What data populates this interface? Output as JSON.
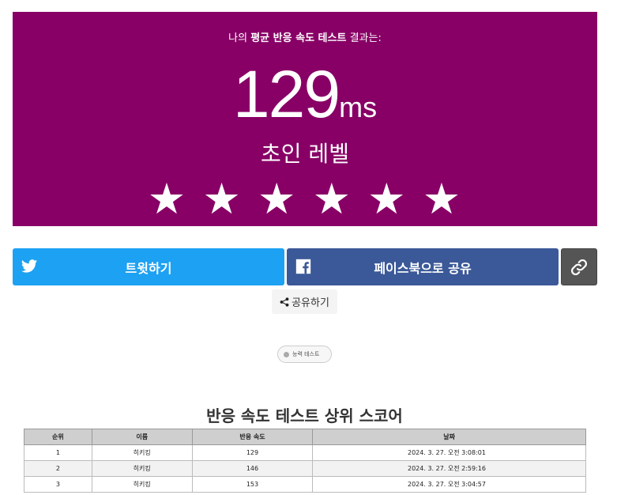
{
  "result": {
    "intro_prefix": "나의 ",
    "intro_bold": "평균 반응 속도 테스트",
    "intro_suffix": " 결과는:",
    "score": "129",
    "unit": "ms",
    "level": "초인 레벨",
    "stars": [
      "★",
      "★",
      "★",
      "★",
      "★",
      "★"
    ],
    "stars_filled": 6,
    "background_color": "#880066"
  },
  "share": {
    "twitter_label": "트윗하기",
    "twitter_icon": "twitter-bird-icon",
    "facebook_label": "페이스북으로 공유",
    "facebook_icon": "facebook-f-icon",
    "link_icon": "chain-link-icon",
    "small_label": "공유하기",
    "small_icon": "share-nodes-icon"
  },
  "tag": {
    "label": "능력 테스트"
  },
  "ranking": {
    "title": "반응 속도 테스트 상위 스코어",
    "columns": [
      "순위",
      "이름",
      "반응 속도",
      "날짜"
    ],
    "rows": [
      [
        "1",
        "히키킹",
        "129",
        "2024. 3. 27. 오전 3:08:01"
      ],
      [
        "2",
        "히키킹",
        "146",
        "2024. 3. 27. 오전 2:59:16"
      ],
      [
        "3",
        "히키킹",
        "153",
        "2024. 3. 27. 오전 3:04:57"
      ]
    ]
  }
}
